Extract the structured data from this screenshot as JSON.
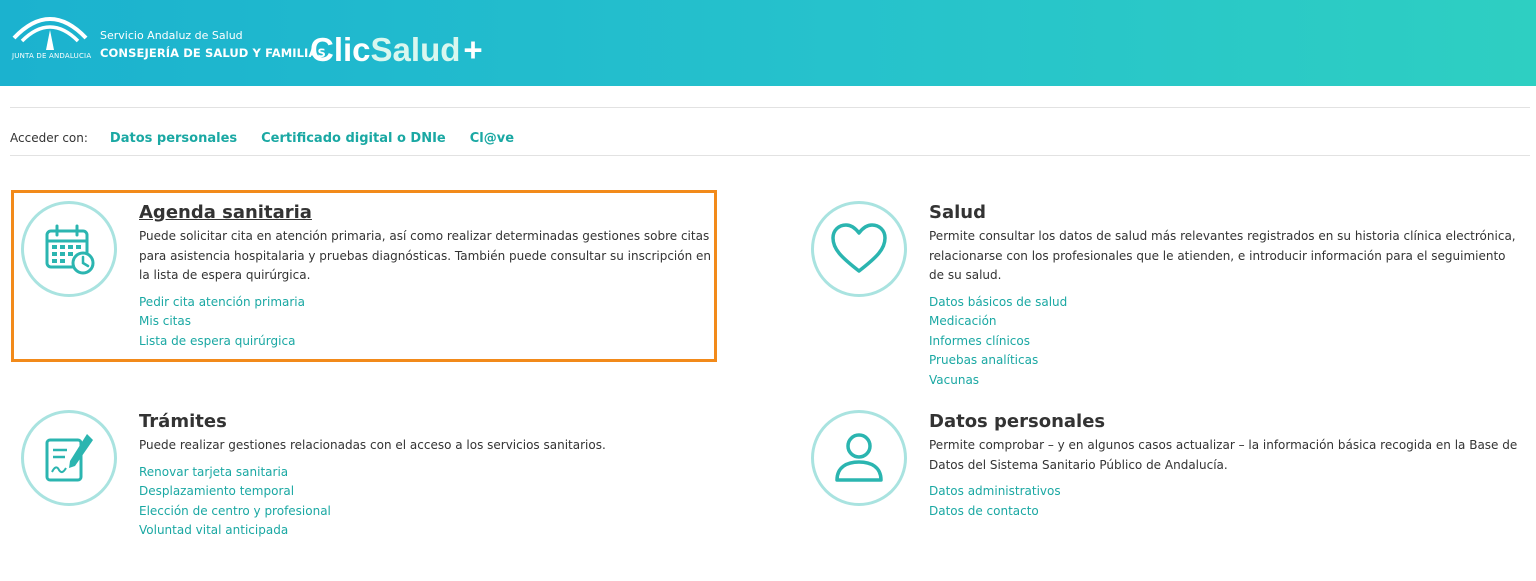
{
  "header": {
    "logo_text": "JUNTA DE ANDALUCIA",
    "org_line1": "Servicio Andaluz de Salud",
    "org_line2": "CONSEJERÍA DE SALUD Y FAMILIAS",
    "brand_part1": "Clic",
    "brand_part2": "Salud",
    "brand_part3": "+"
  },
  "access": {
    "label": "Acceder con:",
    "options": [
      "Datos personales",
      "Certificado digital o DNIe",
      "Cl@ve"
    ]
  },
  "cards": [
    {
      "icon": "calendar-clock-icon",
      "title": "Agenda sanitaria",
      "description": "Puede solicitar cita en atención primaria, así como realizar determinadas gestiones sobre citas para asistencia hospitalaria y pruebas diagnósticas. También puede consultar su inscripción en la lista de espera quirúrgica.",
      "links": [
        "Pedir cita atención primaria",
        "Mis citas",
        "Lista de espera quirúrgica"
      ]
    },
    {
      "icon": "heart-icon",
      "title": "Salud",
      "description": "Permite consultar los datos de salud más relevantes registrados en su historia clínica electrónica, relacionarse con los profesionales que le atienden, e introducir información para el seguimiento de su salud.",
      "links": [
        "Datos básicos de salud",
        "Medicación",
        "Informes clínicos",
        "Pruebas analíticas",
        "Vacunas"
      ]
    },
    {
      "icon": "document-pen-icon",
      "title": "Trámites",
      "description": "Puede realizar gestiones relacionadas con el acceso a los servicios sanitarios.",
      "links": [
        "Renovar tarjeta sanitaria",
        "Desplazamiento temporal",
        "Elección de centro y profesional",
        "Voluntad vital anticipada"
      ]
    },
    {
      "icon": "user-icon",
      "title": "Datos personales",
      "description": "Permite comprobar – y en algunos casos actualizar – la información básica recogida en la Base de Datos del Sistema Sanitario Público de Andalucía.",
      "links": [
        "Datos administrativos",
        "Datos de contacto"
      ]
    }
  ],
  "colors": {
    "header_start": "#1bb2cf",
    "header_end": "#2ecfc2",
    "link": "#1aa8a3",
    "icon_ring": "#a9e3e0",
    "icon_stroke": "#2bb5b0",
    "highlight": "#f28a1a"
  }
}
